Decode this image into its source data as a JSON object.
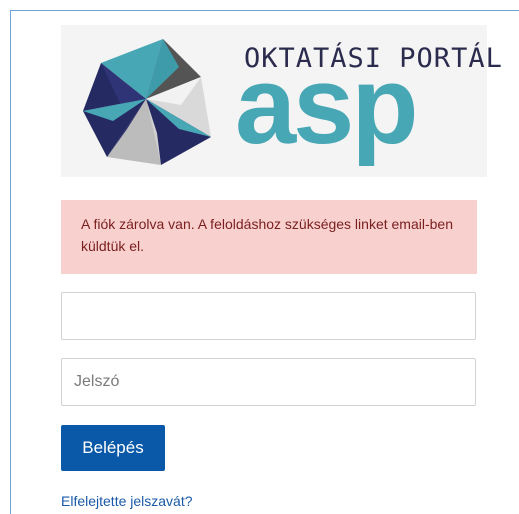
{
  "logo": {
    "title": "OKTATÁSI PORTÁL",
    "brand": "asp",
    "colors": {
      "navy": "#262a63",
      "teal": "#48a7b5",
      "gray": "#bcbcbc",
      "dark_gray": "#545454",
      "light_gray": "#d9d9d9"
    }
  },
  "alert": {
    "message": "A fiók zárolva van. A feloldáshoz szükséges linket email-ben küldtük el.",
    "background": "#f8d0cd"
  },
  "form": {
    "username_value": "",
    "username_placeholder": "",
    "password_placeholder": "Jelszó",
    "login_label": "Belépés",
    "forgot_label": "Elfelejtette jelszavát?"
  },
  "colors": {
    "primary": "#0a58a8",
    "link": "#1a5aa8"
  }
}
